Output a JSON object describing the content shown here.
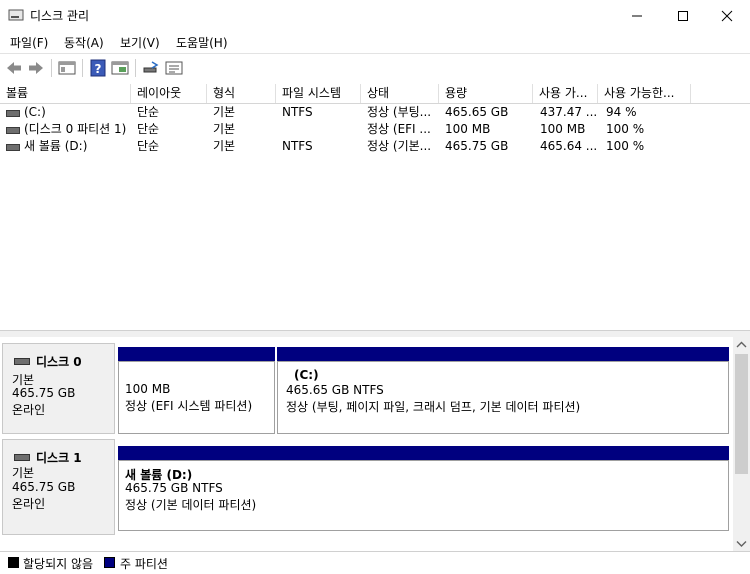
{
  "window": {
    "title": "디스크 관리"
  },
  "menu": [
    {
      "label": "파일(F)"
    },
    {
      "label": "동작(A)"
    },
    {
      "label": "보기(V)"
    },
    {
      "label": "도움말(H)"
    }
  ],
  "toolbar": [
    "back-arrow-icon",
    "forward-arrow-icon",
    "properties-icon",
    "help-icon",
    "show-hide-console-tree-icon",
    "rescan-icon",
    "details-icon"
  ],
  "columns": [
    {
      "label": "볼륨"
    },
    {
      "label": "레이아웃"
    },
    {
      "label": "형식"
    },
    {
      "label": "파일 시스템"
    },
    {
      "label": "상태"
    },
    {
      "label": "용량"
    },
    {
      "label": "사용 가..."
    },
    {
      "label": "사용 가능한..."
    }
  ],
  "volumes": [
    {
      "volume": "(C:)",
      "layout": "단순",
      "type": "기본",
      "fs": "NTFS",
      "status": "정상 (부팅...",
      "capacity": "465.65 GB",
      "free": "437.47 ...",
      "pct": "94 %"
    },
    {
      "volume": "(디스크 0 파티션 1)",
      "layout": "단순",
      "type": "기본",
      "fs": "",
      "status": "정상 (EFI ...",
      "capacity": "100 MB",
      "free": "100 MB",
      "pct": "100 %"
    },
    {
      "volume": "새 볼륨 (D:)",
      "layout": "단순",
      "type": "기본",
      "fs": "NTFS",
      "status": "정상 (기본...",
      "capacity": "465.75 GB",
      "free": "465.64 ...",
      "pct": "100 %"
    }
  ],
  "disks": [
    {
      "name": "디스크 0",
      "kind": "기본",
      "size": "465.75 GB",
      "state": "온라인",
      "partitions": [
        {
          "title": "",
          "size": "100 MB",
          "status": "정상 (EFI 시스템 파티션)"
        },
        {
          "title": "(C:)",
          "size": "465.65 GB NTFS",
          "status": "정상 (부팅, 페이지 파일, 크래시 덤프, 기본 데이터 파티션)"
        }
      ]
    },
    {
      "name": "디스크 1",
      "kind": "기본",
      "size": "465.75 GB",
      "state": "온라인",
      "partitions": [
        {
          "title": "새 볼륨  (D:)",
          "size": "465.75 GB NTFS",
          "status": "정상 (기본 데이터 파티션)"
        }
      ]
    }
  ],
  "legend": [
    {
      "label": "할당되지 않음",
      "color": "#000000"
    },
    {
      "label": "주 파티션",
      "color": "#00007f"
    }
  ]
}
